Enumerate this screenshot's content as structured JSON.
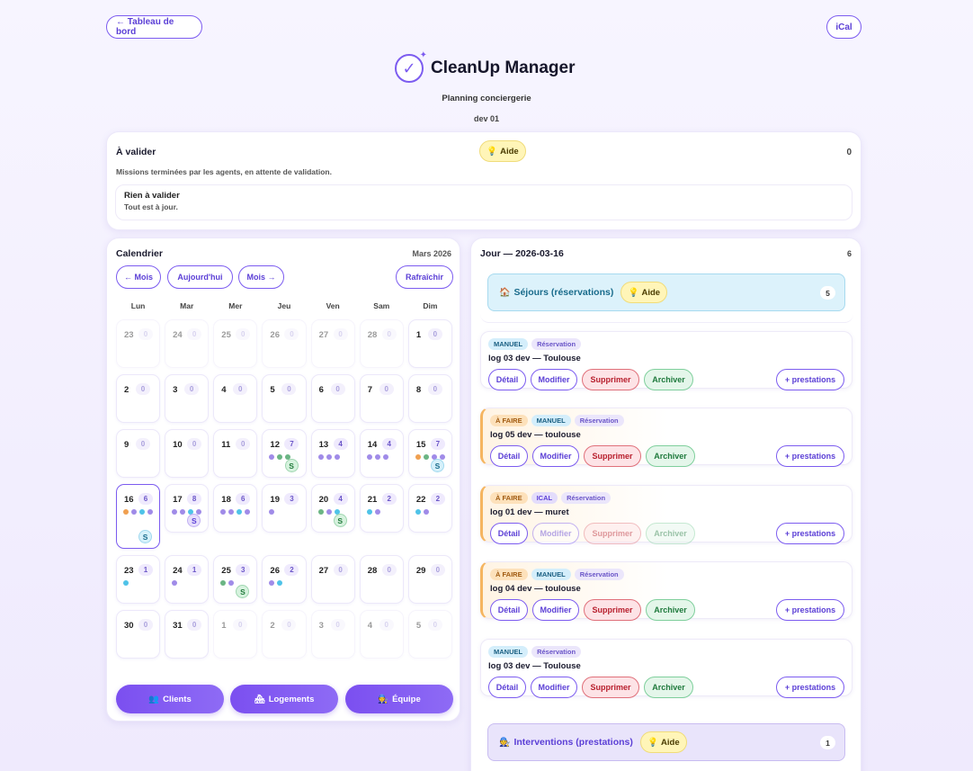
{
  "header": {
    "back_label": "← Tableau de bord",
    "ical_label": "iCal",
    "brand_check": "✓",
    "brand_spark": "✦",
    "brand_title": "CleanUp Manager",
    "subtitle": "Planning conciergerie",
    "subtitle2": "dev 01"
  },
  "validate": {
    "title": "À valider",
    "help_icon": "💡",
    "help_label": "Aide",
    "count": "0",
    "description": "Missions terminées par les agents, en attente de validation.",
    "empty_title": "Rien à valider",
    "empty_sub": "Tout est à jour."
  },
  "calendar": {
    "title": "Calendrier",
    "month": "Mars 2026",
    "prev_label": "← Mois",
    "today_label": "Aujourd'hui",
    "next_label": "Mois →",
    "refresh_label": "Rafraîchir",
    "weekdays": [
      "Lun",
      "Mar",
      "Mer",
      "Jeu",
      "Ven",
      "Sam",
      "Dim"
    ],
    "days": [
      {
        "n": "23",
        "c": "0",
        "out": true
      },
      {
        "n": "24",
        "c": "0",
        "out": true
      },
      {
        "n": "25",
        "c": "0",
        "out": true
      },
      {
        "n": "26",
        "c": "0",
        "out": true
      },
      {
        "n": "27",
        "c": "0",
        "out": true
      },
      {
        "n": "28",
        "c": "0",
        "out": true
      },
      {
        "n": "1",
        "c": "0"
      },
      {
        "n": "2",
        "c": "0"
      },
      {
        "n": "3",
        "c": "0"
      },
      {
        "n": "4",
        "c": "0"
      },
      {
        "n": "5",
        "c": "0"
      },
      {
        "n": "6",
        "c": "0"
      },
      {
        "n": "7",
        "c": "0"
      },
      {
        "n": "8",
        "c": "0"
      },
      {
        "n": "9",
        "c": "0"
      },
      {
        "n": "10",
        "c": "0"
      },
      {
        "n": "11",
        "c": "0"
      },
      {
        "n": "12",
        "c": "7",
        "dots": [
          "p",
          "g",
          "g"
        ],
        "s": "g"
      },
      {
        "n": "13",
        "c": "4",
        "dots": [
          "p",
          "p",
          "p"
        ]
      },
      {
        "n": "14",
        "c": "4",
        "dots": [
          "p",
          "p",
          "p"
        ]
      },
      {
        "n": "15",
        "c": "7",
        "dots": [
          "o",
          "g",
          "p",
          "p"
        ],
        "s": "b"
      },
      {
        "n": "16",
        "c": "6",
        "dots": [
          "o",
          "p",
          "b",
          "p"
        ],
        "s": "b",
        "today": true
      },
      {
        "n": "17",
        "c": "8",
        "dots": [
          "p",
          "p",
          "b",
          "p"
        ],
        "s": "p"
      },
      {
        "n": "18",
        "c": "6",
        "dots": [
          "p",
          "p",
          "b",
          "p"
        ]
      },
      {
        "n": "19",
        "c": "3",
        "dots": [
          "p"
        ]
      },
      {
        "n": "20",
        "c": "4",
        "dots": [
          "g",
          "p",
          "b"
        ],
        "s": "g"
      },
      {
        "n": "21",
        "c": "2",
        "dots": [
          "b",
          "p"
        ]
      },
      {
        "n": "22",
        "c": "2",
        "dots": [
          "b",
          "p"
        ]
      },
      {
        "n": "23",
        "c": "1",
        "dots": [
          "b"
        ]
      },
      {
        "n": "24",
        "c": "1",
        "dots": [
          "p"
        ]
      },
      {
        "n": "25",
        "c": "3",
        "dots": [
          "g",
          "p"
        ],
        "s": "g"
      },
      {
        "n": "26",
        "c": "2",
        "dots": [
          "p",
          "b"
        ]
      },
      {
        "n": "27",
        "c": "0"
      },
      {
        "n": "28",
        "c": "0"
      },
      {
        "n": "29",
        "c": "0"
      },
      {
        "n": "30",
        "c": "0"
      },
      {
        "n": "31",
        "c": "0"
      },
      {
        "n": "1",
        "c": "0",
        "out": true
      },
      {
        "n": "2",
        "c": "0",
        "out": true
      },
      {
        "n": "3",
        "c": "0",
        "out": true
      },
      {
        "n": "4",
        "c": "0",
        "out": true
      },
      {
        "n": "5",
        "c": "0",
        "out": true
      }
    ],
    "s_letter": "S",
    "bottom": {
      "clients_icon": "👥",
      "clients_label": "Clients",
      "logements_icon": "🏘",
      "logements_label": "Logements",
      "equipe_icon": "🧑‍🔧",
      "equipe_label": "Équipe"
    }
  },
  "day_panel": {
    "title": "Jour — 2026-03-16",
    "count": "6",
    "sejours_icon": "🏠",
    "sejours_label": "Séjours (réservations)",
    "sejours_count": "5",
    "interventions_icon": "🧑‍🔧",
    "interventions_label": "Interventions (prestations)",
    "interventions_count": "1",
    "help_icon": "💡",
    "help_label": "Aide",
    "actions": {
      "detail": "Détail",
      "modifier": "Modifier",
      "supprimer": "Supprimer",
      "archiver": "Archiver",
      "prestations": "+ prestations"
    },
    "reservations": [
      {
        "tags": [
          {
            "t": "MANUEL",
            "k": "manuel"
          },
          {
            "t": "Réservation",
            "k": "resa-t"
          }
        ],
        "name": "log 03 dev — Toulouse",
        "todo": false,
        "dim": false
      },
      {
        "tags": [
          {
            "t": "À FAIRE",
            "k": "afaire"
          },
          {
            "t": "MANUEL",
            "k": "manuel"
          },
          {
            "t": "Réservation",
            "k": "resa-t"
          }
        ],
        "name": "log 05 dev — toulouse",
        "todo": true,
        "dim": false
      },
      {
        "tags": [
          {
            "t": "À FAIRE",
            "k": "afaire"
          },
          {
            "t": "ICAL",
            "k": "ical"
          },
          {
            "t": "Réservation",
            "k": "resa-t"
          }
        ],
        "name": "log 01 dev — muret",
        "todo": true,
        "dim": true
      },
      {
        "tags": [
          {
            "t": "À FAIRE",
            "k": "afaire"
          },
          {
            "t": "MANUEL",
            "k": "manuel"
          },
          {
            "t": "Réservation",
            "k": "resa-t"
          }
        ],
        "name": "log 04 dev — toulouse",
        "todo": true,
        "dim": false
      },
      {
        "tags": [
          {
            "t": "MANUEL",
            "k": "manuel"
          },
          {
            "t": "Réservation",
            "k": "resa-t"
          }
        ],
        "name": "log 03 dev — Toulouse",
        "todo": false,
        "dim": false
      }
    ]
  }
}
